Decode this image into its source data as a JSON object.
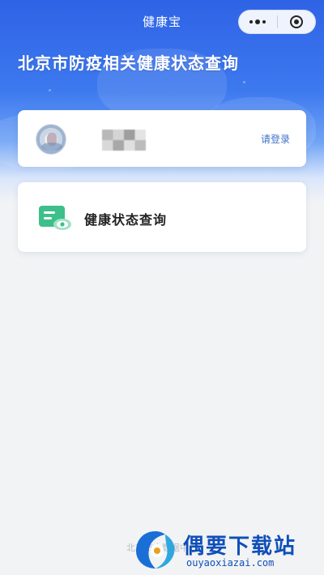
{
  "navbar": {
    "title": "健康宝",
    "more_icon": "more-dots-icon",
    "close_icon": "target-close-icon"
  },
  "hero": {
    "title": "北京市防疫相关健康状态查询"
  },
  "user_card": {
    "avatar_icon": "avatar",
    "login_label": "请登录"
  },
  "health_card": {
    "icon": "health-card-icon",
    "label": "健康状态查询"
  },
  "footer": {
    "text": "北京市大数据中心"
  },
  "watermark": {
    "name": "偶要下载站",
    "url": "ouyaoxiazai.com"
  },
  "colors": {
    "hero_blue": "#2f63e6",
    "link_blue": "#3f72c9",
    "icon_green": "#3dbf8a",
    "page_bg": "#f2f3f5"
  }
}
